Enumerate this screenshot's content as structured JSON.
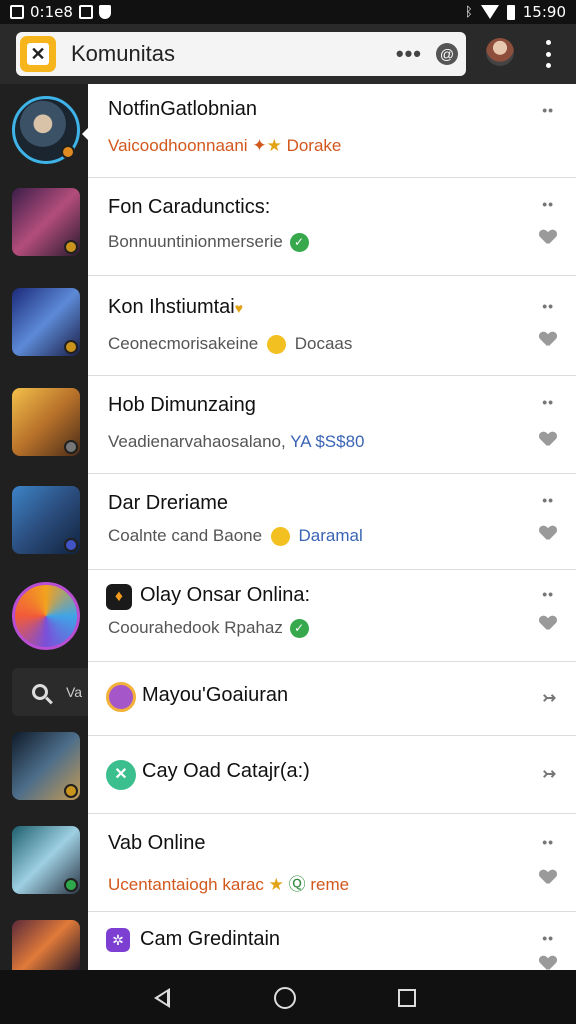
{
  "status_bar": {
    "time": "15:90",
    "left_text": "0:1e8"
  },
  "header": {
    "title": "Komunitas",
    "more_label": "•••",
    "at_label": "@"
  },
  "colors": {
    "accent_logo": "#f6b51c",
    "rail_bg": "#202020",
    "orange_text": "#d2581d",
    "link_blue": "#3a64b4",
    "green_check": "#37a84b"
  },
  "rail": {
    "search_text": "Va",
    "items": [
      {
        "name": "community-avatar-1",
        "icon": "hero-portrait"
      },
      {
        "name": "community-avatar-2",
        "icon": "warriors-art"
      },
      {
        "name": "community-avatar-3",
        "icon": "knight-art"
      },
      {
        "name": "community-avatar-4",
        "icon": "gunner-art"
      },
      {
        "name": "community-avatar-5",
        "icon": "mech-art"
      },
      {
        "name": "community-avatar-6",
        "icon": "cube-logo"
      },
      {
        "name": "community-avatar-7",
        "icon": "soldier-art"
      },
      {
        "name": "community-avatar-8",
        "icon": "rifle-art"
      },
      {
        "name": "community-avatar-9",
        "icon": "fire-art"
      }
    ]
  },
  "chats": [
    {
      "title": "NotfinGatlobnian",
      "sub": "Vaicoodhoonnaani",
      "sub_tail": "Dorake",
      "dots": "••"
    },
    {
      "title": "Fon Caradunctics:",
      "sub": "Bonnuuntinionmerserie",
      "dots": "••"
    },
    {
      "title": "Kon Ihstiumtai",
      "sub": "Ceonecmorisakeine",
      "sub_tail": "Docaas",
      "dots": "••"
    },
    {
      "title": "Hob Dimunzaing",
      "sub": "Veadienarvahaosalano,",
      "sub_tail": "YA $S$80",
      "dots": "••"
    },
    {
      "title": "Dar Dreriame",
      "sub": "Coalnte cand Baone",
      "sub_tail": "Daramal",
      "dots": "••"
    },
    {
      "title": "Olay Onsar Onlina:",
      "sub": "Coourahedook Rpahaz",
      "dots": "••"
    },
    {
      "title": "Mayou'Goaiuran",
      "arrow": "↣"
    },
    {
      "title": "Cay Oad Catajr(a:)",
      "arrow": "↣"
    },
    {
      "title": "Vab Online",
      "sub": "Ucentantaiogh karac",
      "sub_tail": "reme",
      "dots": "••"
    },
    {
      "title": "Cam Gredintain",
      "dots": "••"
    }
  ]
}
